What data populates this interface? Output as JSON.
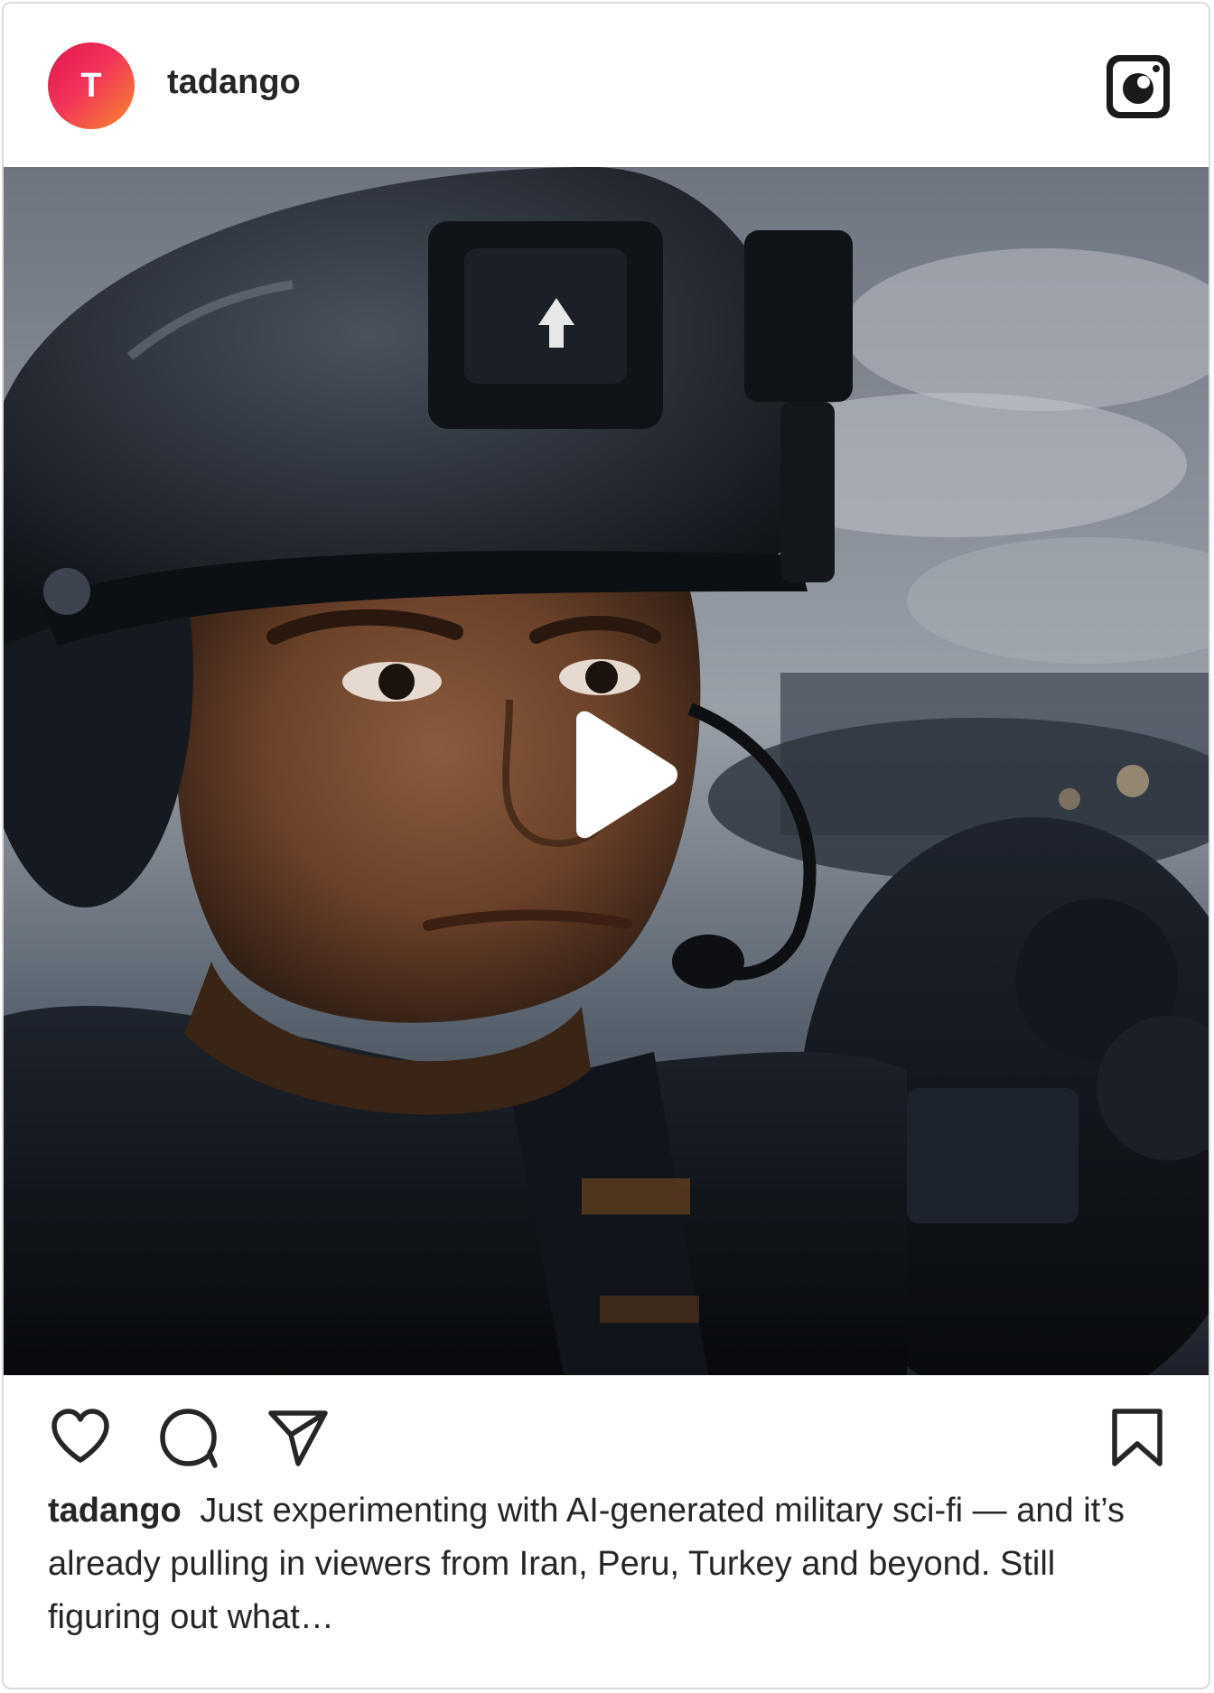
{
  "post": {
    "avatar_initial": "T",
    "username": "tadango",
    "caption_username": "tadango",
    "caption_text": "Just experimenting with AI-generated military sci-fi — and it’s already pulling in viewers from Iran, Peru, Turkey and beyond. Still figuring out what…"
  },
  "icons": {
    "header_logo": "instagram-icon",
    "media_overlay": "play-icon",
    "actions": [
      "heart-icon",
      "comment-icon",
      "send-icon",
      "bookmark-icon"
    ]
  },
  "colors": {
    "avatar_gradient_start": "#e0164f",
    "avatar_gradient_end": "#f88a2a",
    "text": "#262626",
    "border": "#dbdbdb"
  }
}
